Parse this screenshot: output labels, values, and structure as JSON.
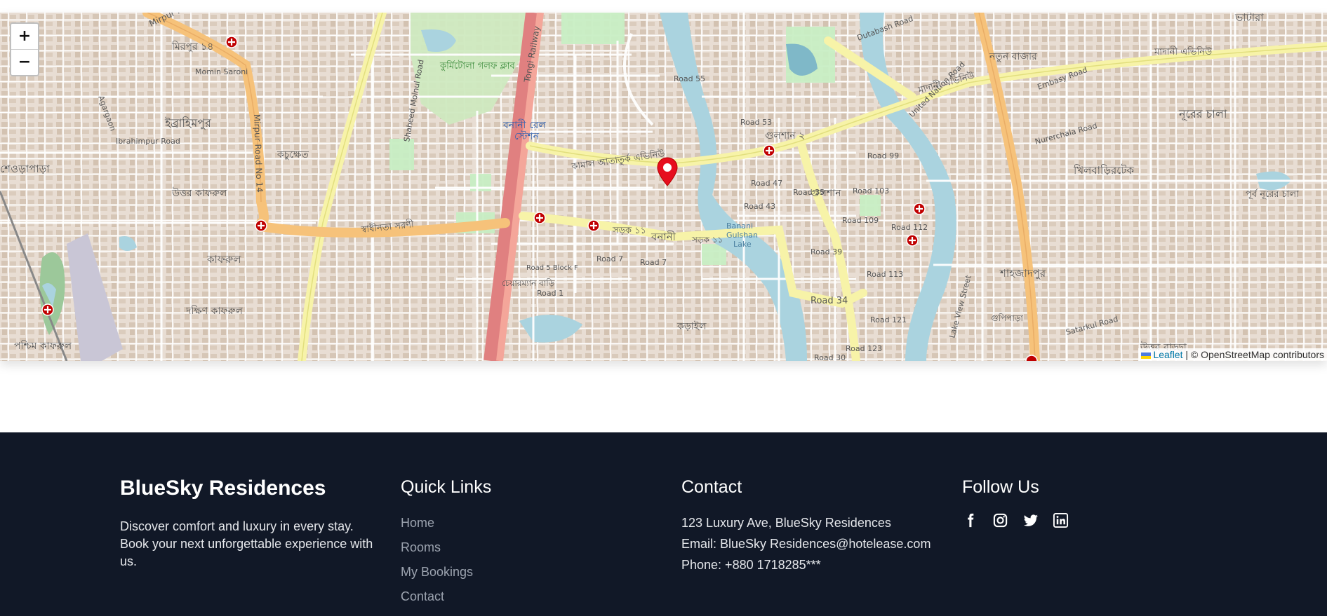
{
  "map": {
    "zoom_in_label": "+",
    "zoom_out_label": "−",
    "attribution_link": "Leaflet",
    "attribution_text": "| © OpenStreetMap contributors",
    "road_color": "#f7f2a8",
    "major_road_color": "#f6c27a",
    "rail_color": "#e08080",
    "water_color": "#aad3df",
    "park_color": "#c8f0c8",
    "marker_color": "#e60e1e",
    "place_labels": [
      "Mirpur road-14",
      "মিরপুর ১৪",
      "Momin Saroni",
      "Agargaon",
      "ইব্রাহিমপুর",
      "শেওড়াপাড়া",
      "কচুক্ষেত",
      "উত্তর কাফরুল",
      "কাফরুল",
      "দক্ষিণ কাফরুল",
      "পশ্চিম কাফরুল",
      "Mirpur Road No 14",
      "Ibrahimpur Road",
      "Shaheed Moinul Road",
      "কুর্মিটোলা গলফ ক্লাব",
      "বনানী রেল স্টেশন",
      "Tongi Railway",
      "Road 55",
      "কামাল আতাতুর্ক এভিনিউ",
      "স্বাধীনতা সরণী",
      "সড়ক ১১",
      "বনানী",
      "Road 7",
      "Road 5 Block F",
      "Road 1",
      "চেয়ারম্যান বাড়ি",
      "গুলশান ২",
      "গুলশান",
      "Road 53",
      "Road 47",
      "Road 43",
      "Road 35",
      "Road 34",
      "Road 39",
      "Road 99",
      "Road 103",
      "Road 109",
      "Road 112",
      "Road 113",
      "Road 121",
      "Road 123",
      "Banani Gulshan Lake",
      "United Nation Road",
      "মাদানী এভিনিউ",
      "Dutabash Road",
      "নতুন বাজার",
      "Embasy Road",
      "ভাটারা",
      "নূরের চালা",
      "Nurerchala Road",
      "খিলবাড়িরটেক",
      "পূর্ব নূরের চালা",
      "Lake View Street",
      "শাহজাদপুর",
      "গুপিপাড়া",
      "Satarkul Road",
      "উত্তর বাড্ডা",
      "কড়াইল",
      "Road 30"
    ]
  },
  "footer": {
    "brand": {
      "title": "BlueSky Residences",
      "description": "Discover comfort and luxury in every stay. Book your next unforgettable experience with us."
    },
    "quick_links": {
      "title": "Quick Links",
      "items": [
        "Home",
        "Rooms",
        "My Bookings",
        "Contact"
      ]
    },
    "contact": {
      "title": "Contact",
      "address": "123 Luxury Ave, BlueSky Residences",
      "email": "Email: BlueSky Residences@hotelease.com",
      "phone": "Phone: +880 1718285***"
    },
    "follow": {
      "title": "Follow Us",
      "icons": [
        "facebook-icon",
        "instagram-icon",
        "twitter-icon",
        "linkedin-icon"
      ]
    },
    "colors": {
      "background": "#111827",
      "link": "#9ca3af",
      "text": "#e5e7eb"
    }
  }
}
